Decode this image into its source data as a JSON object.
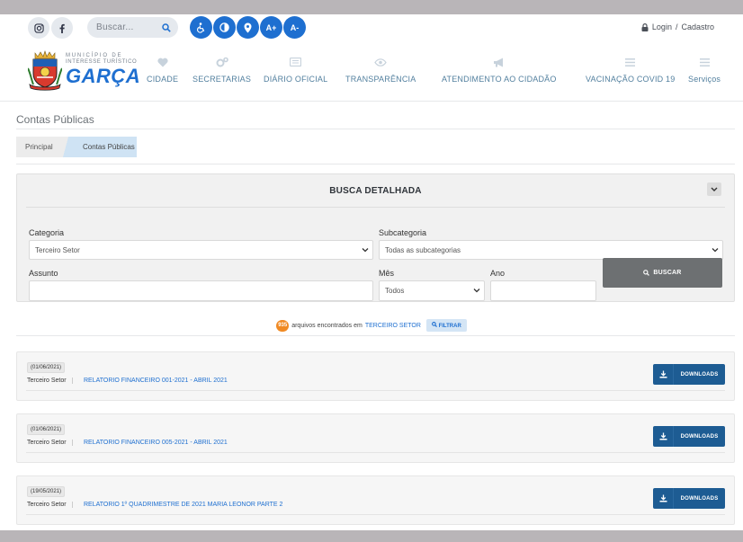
{
  "header": {
    "search_placeholder": "Buscar...",
    "accessibility": {
      "font_increase": "A+",
      "font_decrease": "A-"
    },
    "login": {
      "login_label": "Login",
      "separator": "/",
      "register_label": "Cadastro"
    }
  },
  "logo": {
    "line1": "MUNICÍPIO DE",
    "line2": "INTERESSE TURÍSTICO",
    "name": "GARÇA"
  },
  "nav": [
    {
      "label": "CIDADE",
      "icon": "heart-icon"
    },
    {
      "label": "SECRETARIAS",
      "icon": "gears-icon"
    },
    {
      "label": "DIÁRIO OFICIAL",
      "icon": "newspaper-icon"
    },
    {
      "label": "TRANSPARÊNCIA",
      "icon": "eye-icon"
    },
    {
      "label": "ATENDIMENTO AO CIDADÃO",
      "icon": "megaphone-icon"
    },
    {
      "label": "VACINAÇÃO COVID 19",
      "icon": "menu-icon"
    },
    {
      "label": "Serviços",
      "icon": "menu-icon"
    }
  ],
  "page": {
    "title": "Contas Públicas",
    "breadcrumb": [
      "Principal",
      "Contas Públicas"
    ]
  },
  "search_panel": {
    "title": "BUSCA DETALHADA",
    "categoria_label": "Categoria",
    "categoria_value": "Terceiro Setor",
    "subcategoria_label": "Subcategoria",
    "subcategoria_value": "Todas as subcategorias",
    "assunto_label": "Assunto",
    "assunto_value": "",
    "mes_label": "Mês",
    "mes_value": "Todos",
    "ano_label": "Ano",
    "ano_value": "",
    "button_label": "BUSCAR"
  },
  "results": {
    "count": "935",
    "text": "arquivos encontrados em",
    "category": "TERCEIRO SETOR",
    "filter_label": "FILTRAR"
  },
  "items": [
    {
      "date": "(01/06/2021)",
      "category": "Terceiro Setor",
      "title": "RELATORIO FINANCEIRO 001-2021 - ABRIL 2021",
      "button": "DOWNLOADS"
    },
    {
      "date": "(01/06/2021)",
      "category": "Terceiro Setor",
      "title": "RELATORIO FINANCEIRO 005-2021 - ABRIL 2021",
      "button": "DOWNLOADS"
    },
    {
      "date": "(19/05/2021)",
      "category": "Terceiro Setor",
      "title": "RELATORIO 1º QUADRIMESTRE DE 2021 MARIA LEONOR PARTE 2",
      "button": "DOWNLOADS"
    }
  ],
  "colors": {
    "accent": "#1e6fd0",
    "nav_text": "#53809f",
    "download_button": "#1d5c93",
    "search_button": "#6d7072",
    "count_badge": "#f08a24"
  }
}
